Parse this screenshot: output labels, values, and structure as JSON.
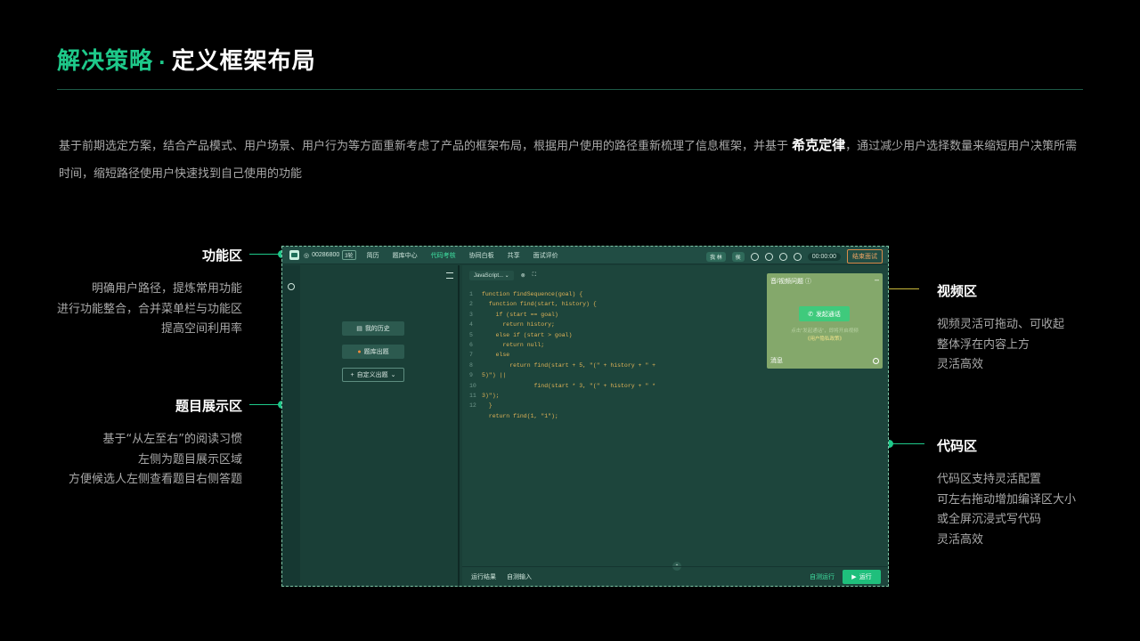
{
  "header": {
    "title_accent": "解决策略",
    "title_dot": "·",
    "title_main": "定义框架布局"
  },
  "intro": {
    "text_before": "基于前期选定方案，结合产品模式、用户场景、用户行为等方面重新考虑了产品的框架布局，根据用户使用的路径重新梳理了信息框架，并基于",
    "emphasis": "希克定律",
    "text_after": "，通过减少用户选择数量来缩短用户决策所需时间，缩短路径使用户快速找到自己使用的功能"
  },
  "annotations": {
    "function_area": {
      "heading": "功能区",
      "lines": [
        "明确用户路径，提炼常用功能",
        "进行功能整合，合并菜单栏与功能区",
        "提高空间利用率"
      ]
    },
    "question_area": {
      "heading": "题目展示区",
      "lines": [
        "基于“从左至右”的阅读习惯",
        "左侧为题目展示区域",
        "方便候选人左侧查看题目右侧答题"
      ]
    },
    "video_area": {
      "heading": "视频区",
      "lines": [
        "视频灵活可拖动、可收起",
        "整体浮在内容上方",
        "灵活高效"
      ]
    },
    "code_area": {
      "heading": "代码区",
      "lines": [
        "代码区支持灵活配置",
        "可左右拖动增加编译区大小",
        "或全屏沉浸式写代码",
        "灵活高效"
      ]
    }
  },
  "app": {
    "candidate_id": "00286800",
    "round_badge": "3轮",
    "nav": [
      "简历",
      "题库中心",
      "代码考核",
      "协同白板",
      "共享",
      "面试评价"
    ],
    "nav_active_index": 2,
    "chip_me": "我 林",
    "chip_other": "侯",
    "timer": "00:00:00",
    "end_button": "结束面试",
    "left_buttons": {
      "history": "我的历史",
      "bank": "题库出题",
      "custom": "自定义出题"
    },
    "language": "JavaScript...",
    "code_lines": [
      {
        "n": "1",
        "t": "function findSequence(goal) {"
      },
      {
        "n": "2",
        "t": "  function find(start, history) {"
      },
      {
        "n": "3",
        "t": "    if (start == goal)"
      },
      {
        "n": "4",
        "t": "      return history;"
      },
      {
        "n": "5",
        "t": "    else if (start > goal)"
      },
      {
        "n": "6",
        "t": "      return null;"
      },
      {
        "n": "7",
        "t": "    else"
      },
      {
        "n": "8",
        "t": "        return find(start + 5, \"(\" + history + \" +"
      },
      {
        "n": "9",
        "t": "5)\") ||"
      },
      {
        "n": "10",
        "t": "               find(start * 3, \"(\" + history + \" *"
      },
      {
        "n": "11",
        "t": "3)\");"
      },
      {
        "n": "12",
        "t": "  }"
      },
      {
        "n": "",
        "t": "  return find(1, \"1\");"
      }
    ],
    "footer": {
      "run_result": "运行结果",
      "self_input": "自测输入",
      "self_run": "自测运行",
      "run": "运行"
    },
    "video": {
      "title": "音/视频问题",
      "call_button": "发起通话",
      "tip_line1": "点击\"发起通话\"，即将开启视频",
      "tip_line2": "《用户隐私政策》",
      "message": "消息"
    }
  },
  "colors": {
    "accent": "#1ec98a",
    "app_bg": "#1a3f37",
    "video_bg": "#84a86b",
    "code_text": "#e0b357",
    "video_marker": "#f2e132"
  }
}
